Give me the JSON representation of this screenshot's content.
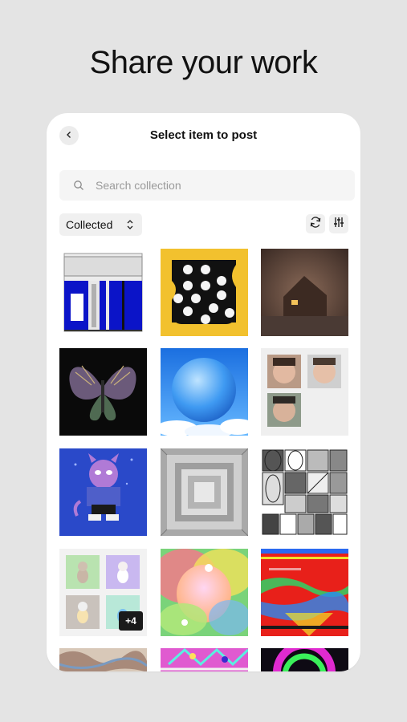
{
  "header": {
    "headline": "Share your work"
  },
  "card": {
    "title": "Select item to post",
    "back_icon": "chevron-left-icon"
  },
  "search": {
    "placeholder": "Search collection",
    "icon": "search-icon"
  },
  "filter": {
    "selected": "Collected",
    "icon": "chevron-up-down-icon"
  },
  "toolbar": {
    "refresh_icon": "refresh-icon",
    "filter_icon": "sliders-icon"
  },
  "items": [
    {
      "name": "blue-window-art"
    },
    {
      "name": "yellow-dots-art"
    },
    {
      "name": "dark-house-art"
    },
    {
      "name": "moth-art"
    },
    {
      "name": "blue-sphere-art"
    },
    {
      "name": "faces-collage-art"
    },
    {
      "name": "purple-creature-art"
    },
    {
      "name": "grey-squares-art"
    },
    {
      "name": "sketch-grid-art"
    },
    {
      "name": "bunny-collage-art",
      "badge": "+4"
    },
    {
      "name": "pastel-blur-art"
    },
    {
      "name": "red-glitch-art"
    },
    {
      "name": "marble-art"
    },
    {
      "name": "pink-pattern-art"
    },
    {
      "name": "neon-ring-art"
    }
  ],
  "colors": {
    "background": "#e4e4e4",
    "card": "#ffffff",
    "accent_yellow": "#f2c12e"
  }
}
